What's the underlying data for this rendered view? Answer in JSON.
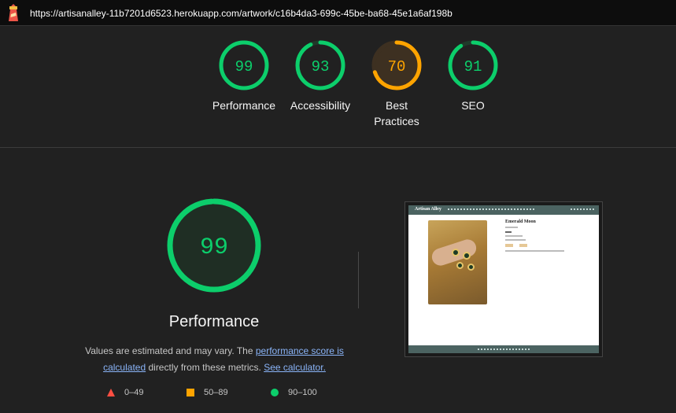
{
  "browser": {
    "url": "https://artisanalley-11b7201d6523.herokuapp.com/artwork/c16b4da3-699c-45be-ba68-45e1a6af198b"
  },
  "summary_gauges": [
    {
      "score": "99",
      "label": "Performance",
      "color": "#0cce6b",
      "fraction": 0.99
    },
    {
      "score": "93",
      "label": "Accessibility",
      "color": "#0cce6b",
      "fraction": 0.93
    },
    {
      "score": "70",
      "label": "Best Practices",
      "color": "#ffa400",
      "fraction": 0.7
    },
    {
      "score": "91",
      "label": "SEO",
      "color": "#0cce6b",
      "fraction": 0.91
    }
  ],
  "performance": {
    "score": "99",
    "fraction": 0.99,
    "color": "#0cce6b",
    "title": "Performance",
    "desc_prefix": "Values are estimated and may vary. The ",
    "link_score": "performance score is calculated",
    "desc_middle": " directly from these metrics. ",
    "link_calculator": "See calculator.",
    "legend": [
      {
        "range": "0–49",
        "shape": "triangle",
        "color": "#ff4e42"
      },
      {
        "range": "50–89",
        "shape": "square",
        "color": "#ffa400"
      },
      {
        "range": "90–100",
        "shape": "circle",
        "color": "#0cce6b"
      }
    ]
  },
  "screenshot": {
    "brand": "Artisan Alley",
    "title": "Emerald Moon"
  }
}
